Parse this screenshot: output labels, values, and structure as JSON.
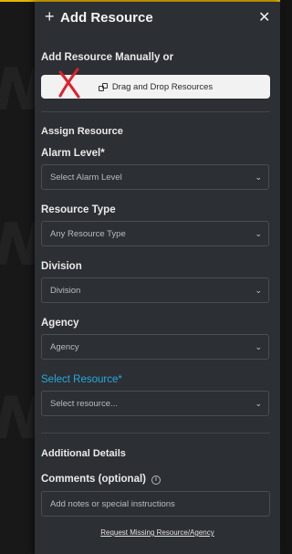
{
  "header": {
    "plus_symbol": "+",
    "title": "Add Resource",
    "close_symbol": "✕"
  },
  "manual": {
    "heading": "Add Resource Manually or",
    "drag_drop_label": "Drag and Drop Resources"
  },
  "assign": {
    "section_title": "Assign Resource",
    "alarm_level": {
      "label": "Alarm Level*",
      "placeholder": "Select Alarm Level"
    },
    "resource_type": {
      "label": "Resource Type",
      "placeholder": "Any Resource Type"
    },
    "division": {
      "label": "Division",
      "placeholder": "Division"
    },
    "agency": {
      "label": "Agency",
      "placeholder": "Agency"
    },
    "select_resource": {
      "label": "Select Resource*",
      "placeholder": "Select resource..."
    }
  },
  "details": {
    "section_title": "Additional Details",
    "comments_label": "Comments (optional)",
    "comments_placeholder": "Add notes or special instructions",
    "info_symbol": "i"
  },
  "request_link": "Request Missing Resource/Agency",
  "chevron_symbol": "⌄",
  "colors": {
    "accent": "#27a9e0",
    "panel": "#2c2f33",
    "mark": "#e0202a",
    "topbar": "#e8b400"
  }
}
